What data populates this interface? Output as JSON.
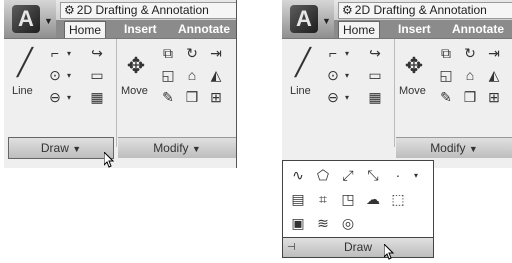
{
  "ribbon": {
    "workspace": "2D Drafting & Annotation",
    "tabs": [
      "Home",
      "Insert",
      "Annotate"
    ]
  },
  "draw_panel": {
    "line_label": "Line",
    "title": "Draw"
  },
  "modify_panel": {
    "move_label": "Move",
    "title": "Modify"
  },
  "flyout": {
    "title": "Draw"
  },
  "icons": {
    "app": "autocad-app-icon",
    "gear": "gear-icon"
  }
}
